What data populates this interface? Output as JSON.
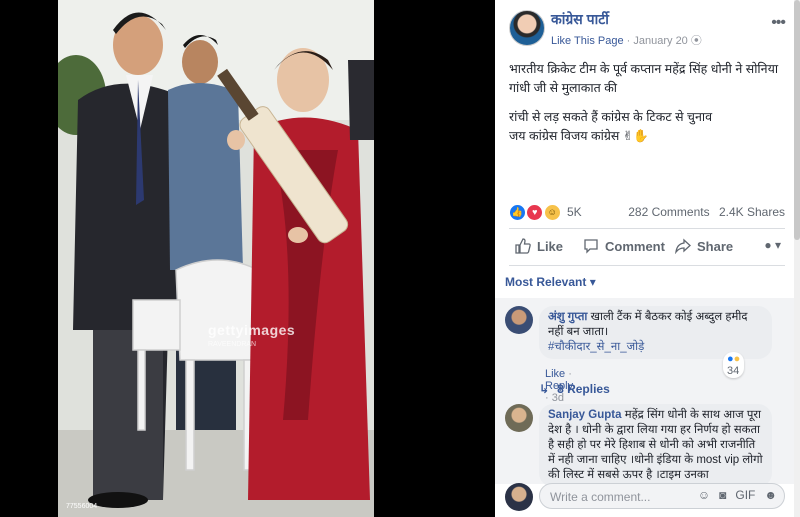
{
  "photo": {
    "watermark": "gettyimages",
    "watermark_credit": "RAVEENDRAN",
    "image_id": "77556004"
  },
  "post": {
    "page_name": "कांग्रेस पार्टी",
    "like_page": "Like This Page",
    "date": "January 20",
    "text_line1": "भारतीय क्रिकेट टीम के पूर्व कप्तान महेंद्र सिंह धोनी ने सोनिया गांधी जी से मुलाकात की",
    "text_line2": "रांची से लड़ सकते हैं कांग्रेस के टिकट से चुनाव",
    "text_line3": "जय कांग्रेस विजय कांग्रेस ✌✋",
    "reactions_count": "5K",
    "comments_count": "282 Comments",
    "shares_count": "2.4K Shares"
  },
  "actions": {
    "like": "Like",
    "comment": "Comment",
    "share": "Share"
  },
  "comments": {
    "sort_label": "Most Relevant",
    "items": [
      {
        "author": "अंशु गुप्ता",
        "text": "खाली टैंक में बैठकर कोई अब्दुल हमीद नहीं बन जाता।",
        "hashtag": "#चौकीदार_से_ना_जोड़े",
        "like": "Like",
        "reply": "Reply",
        "age": "3d",
        "reactions": "34",
        "replies": "8 Replies"
      },
      {
        "author": "Sanjay Gupta",
        "text": "महेंद्र सिंग धोनी के साथ आज पूरा देश है । धोनी के द्वारा लिया गया हर निर्णय हो सकता है सही हो पर मेरे हिशाब से धोनी को अभी राजनीति में नही जाना चाहिए ।धोनी इंडिया के most vip लोगो की लिस्ट में सबसे ऊपर है ।टाइम उनका"
      }
    ],
    "write_placeholder": "Write a comment..."
  },
  "colors": {
    "link": "#385898",
    "text": "#1d2129",
    "muted": "#90949c"
  }
}
